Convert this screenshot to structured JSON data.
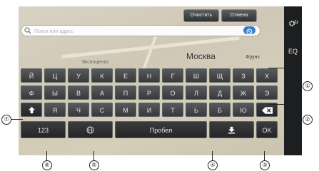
{
  "top_buttons": {
    "clear": "Очистить",
    "cancel": "Отмена"
  },
  "search": {
    "placeholder": "Поиск или адрес"
  },
  "map": {
    "city": "Москва",
    "label_left": "Экспоцентр",
    "label_right": "Фрунз"
  },
  "sidebar": {
    "settings_icon": "gear-icon",
    "eq": "EQ"
  },
  "keys": {
    "row1": [
      "Й",
      "Ц",
      "У",
      "К",
      "Е",
      "Н",
      "Г",
      "Ш",
      "Щ",
      "З",
      "Х"
    ],
    "row2": [
      "Ф",
      "Ы",
      "В",
      "А",
      "П",
      "Р",
      "О",
      "Л",
      "Д",
      "Ж",
      "Э"
    ],
    "row3": [
      "Я",
      "Ч",
      "С",
      "М",
      "И",
      "Т",
      "Ь",
      "Б",
      "Ю"
    ],
    "shift_icon": "shift-arrow-icon",
    "backspace_icon": "backspace-icon",
    "numbers": "123",
    "globe_icon": "globe-icon",
    "space": "Пробел",
    "download_icon": "download-icon",
    "ok": "OK"
  },
  "callouts": [
    "①",
    "②",
    "③",
    "④",
    "⑤",
    "⑥",
    "⑦"
  ]
}
